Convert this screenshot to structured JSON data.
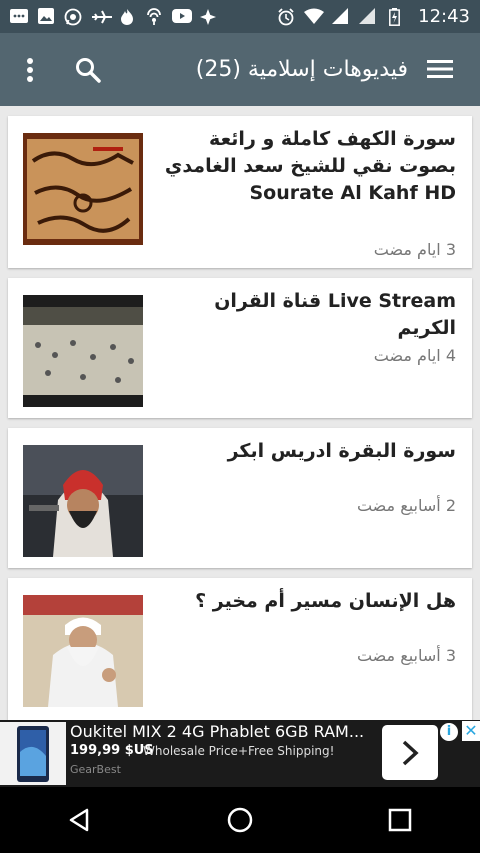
{
  "status_bar": {
    "time": "12:43",
    "left_icons": [
      "message-icon",
      "image-icon",
      "whatsapp-icon",
      "airplane-icon",
      "fire-icon",
      "location-icon",
      "youtube-icon",
      "apps-icon"
    ],
    "right_icons": [
      "alarm-icon",
      "wifi-icon",
      "signal-icon",
      "signal-icon",
      "battery-icon"
    ]
  },
  "app_bar": {
    "title": "فيديوهات إسلامية (25)"
  },
  "videos": [
    {
      "title": "سورة الكهف كاملة  و رائعة  بصوت نقي للشيخ سعد الغامدي  Sourate Al Kahf HD",
      "time": "3 ايام مضت"
    },
    {
      "title": "Live Stream قناة القران الكريم",
      "time": "4 ايام مضت"
    },
    {
      "title": "سورة البقرة ادريس ابكر",
      "time": "2 أسابيع مضت"
    },
    {
      "title": "هل الإنسان مسير أم مخير ؟",
      "time": "3 أسابيع مضت"
    }
  ],
  "ad": {
    "title": "Oukitel MIX 2 4G Phablet 6GB RAM...",
    "price": "199,99 $US",
    "description": "Wholesale Price+Free Shipping!",
    "brand": "GearBest"
  },
  "colors": {
    "status_bar": "#3d4f59",
    "app_bar": "#536670",
    "background": "#e9e9e9"
  }
}
